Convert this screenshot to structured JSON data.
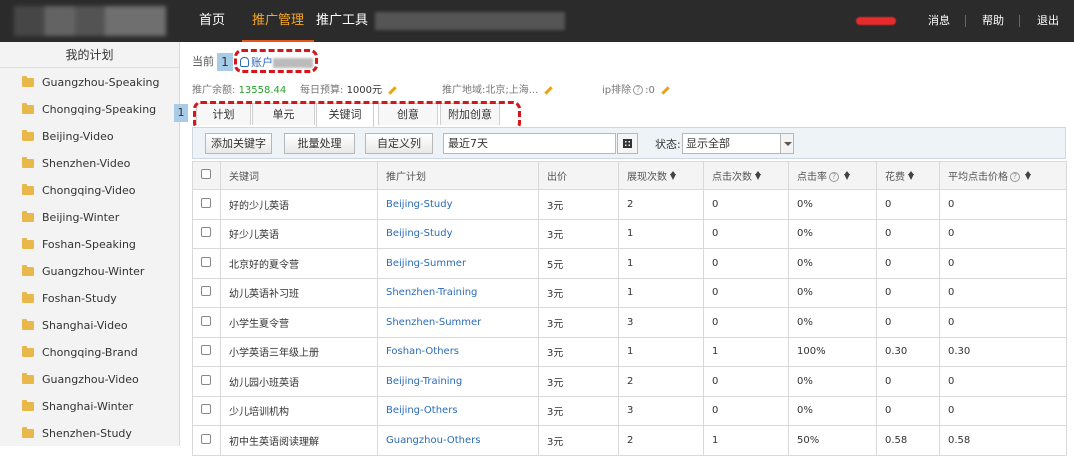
{
  "topbar": {
    "nav": [
      "首页",
      "推广管理",
      "推广工具"
    ],
    "active_nav": "推广管理",
    "right": [
      "消息",
      "帮助",
      "退出"
    ]
  },
  "sidebar": {
    "title": "我的计划",
    "items": [
      "Guangzhou-Speaking",
      "Chongqing-Speaking",
      "Beijing-Video",
      "Shenzhen-Video",
      "Chongqing-Video",
      "Beijing-Winter",
      "Foshan-Speaking",
      "Guangzhou-Winter",
      "Foshan-Study",
      "Shanghai-Video",
      "Chongqing-Brand",
      "Guangzhou-Video",
      "Shanghai-Winter",
      "Shenzhen-Study"
    ],
    "marker": "1"
  },
  "crumb": {
    "label": "当前",
    "num": "1",
    "account": "账户"
  },
  "info": {
    "balance_label": "推广余额:",
    "balance": "13558.44",
    "budget_label": "每日预算:",
    "budget": "1000元",
    "region_label": "推广地域:",
    "region": "北京;上海...",
    "ip_label": "ip排除",
    "ip_value": ":0"
  },
  "tabs": [
    "计划",
    "单元",
    "关键词",
    "创意",
    "附加创意"
  ],
  "active_tab": "关键词",
  "toolbar": {
    "add_keyword": "添加关键字",
    "batch": "批量处理",
    "custom_cols": "自定义列",
    "date": "最近7天",
    "status_label": "状态:",
    "status_value": "显示全部"
  },
  "table": {
    "headers": [
      "关键词",
      "推广计划",
      "出价",
      "展现次数",
      "点击次数",
      "点击率",
      "花费",
      "平均点击价格"
    ],
    "rows": [
      [
        "好的少儿英语",
        "Beijing-Study",
        "3元",
        "2",
        "0",
        "0%",
        "0",
        "0"
      ],
      [
        "好少儿英语",
        "Beijing-Study",
        "3元",
        "1",
        "0",
        "0%",
        "0",
        "0"
      ],
      [
        "北京好的夏令营",
        "Beijing-Summer",
        "5元",
        "1",
        "0",
        "0%",
        "0",
        "0"
      ],
      [
        "幼儿英语补习班",
        "Shenzhen-Training",
        "3元",
        "1",
        "0",
        "0%",
        "0",
        "0"
      ],
      [
        "小学生夏令营",
        "Shenzhen-Summer",
        "3元",
        "3",
        "0",
        "0%",
        "0",
        "0"
      ],
      [
        "小学英语三年级上册",
        "Foshan-Others",
        "3元",
        "1",
        "1",
        "100%",
        "0.30",
        "0.30"
      ],
      [
        "幼儿园小班英语",
        "Beijing-Training",
        "3元",
        "2",
        "0",
        "0%",
        "0",
        "0"
      ],
      [
        "少儿培训机构",
        "Beijing-Others",
        "3元",
        "3",
        "0",
        "0%",
        "0",
        "0"
      ],
      [
        "初中生英语阅读理解",
        "Guangzhou-Others",
        "3元",
        "2",
        "1",
        "50%",
        "0.58",
        "0.58"
      ]
    ]
  }
}
